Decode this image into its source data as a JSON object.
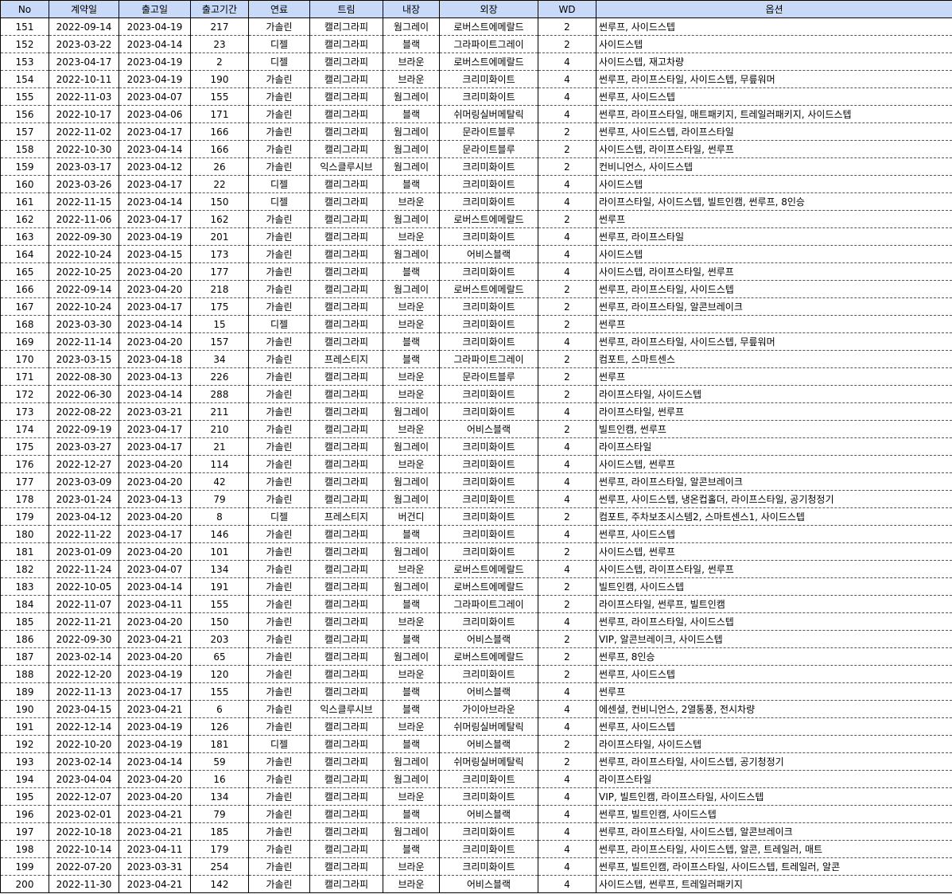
{
  "columns": [
    "No",
    "계약일",
    "출고일",
    "출고기간",
    "연료",
    "트림",
    "내장",
    "외장",
    "WD",
    "옵션"
  ],
  "header_color": "#c9daf8",
  "rows": [
    [
      "151",
      "2022-09-14",
      "2023-04-19",
      "217",
      "가솔린",
      "캘리그라피",
      "웜그레이",
      "로버스트에메랄드",
      "2",
      "썬루프, 사이드스텝"
    ],
    [
      "152",
      "2023-03-22",
      "2023-04-14",
      "23",
      "디젤",
      "캘리그라피",
      "블랙",
      "그라파이트그레이",
      "2",
      "사이드스텝"
    ],
    [
      "153",
      "2023-04-17",
      "2023-04-19",
      "2",
      "디젤",
      "캘리그라피",
      "브라운",
      "로버스트에메랄드",
      "4",
      "사이드스텝, 재고차량"
    ],
    [
      "154",
      "2022-10-11",
      "2023-04-19",
      "190",
      "가솔린",
      "캘리그라피",
      "브라운",
      "크리미화이트",
      "4",
      "썬루프, 라이프스타일, 사이드스텝, 무릎워머"
    ],
    [
      "155",
      "2022-11-03",
      "2023-04-07",
      "155",
      "가솔린",
      "캘리그라피",
      "웜그레이",
      "크리미화이트",
      "4",
      "썬루프, 사이드스텝"
    ],
    [
      "156",
      "2022-10-17",
      "2023-04-06",
      "171",
      "가솔린",
      "캘리그라피",
      "블랙",
      "쉬머링실버메탈릭",
      "4",
      "썬루프, 라이프스타일, 매트패키지, 트레일러패키지, 사이드스텝"
    ],
    [
      "157",
      "2022-11-02",
      "2023-04-17",
      "166",
      "가솔린",
      "캘리그라피",
      "웜그레이",
      "문라이트블루",
      "2",
      "썬루프, 사이드스텝, 라이프스타일"
    ],
    [
      "158",
      "2022-10-30",
      "2023-04-14",
      "166",
      "가솔린",
      "캘리그라피",
      "웜그레이",
      "문라이트블루",
      "2",
      "사이드스텝, 라이프스타일, 썬루프"
    ],
    [
      "159",
      "2023-03-17",
      "2023-04-12",
      "26",
      "가솔린",
      "익스클루시브",
      "웜그레이",
      "크리미화이트",
      "2",
      "컨비니언스, 사이드스텝"
    ],
    [
      "160",
      "2023-03-26",
      "2023-04-17",
      "22",
      "디젤",
      "캘리그라피",
      "블랙",
      "크리미화이트",
      "4",
      "사이드스텝"
    ],
    [
      "161",
      "2022-11-15",
      "2023-04-14",
      "150",
      "디젤",
      "캘리그라피",
      "브라운",
      "크리미화이트",
      "4",
      "라이프스타일, 사이드스텝, 빌트인캠, 썬루프, 8인승"
    ],
    [
      "162",
      "2022-11-06",
      "2023-04-17",
      "162",
      "가솔린",
      "캘리그라피",
      "웜그레이",
      "로버스트에메랄드",
      "2",
      "썬루프"
    ],
    [
      "163",
      "2022-09-30",
      "2023-04-19",
      "201",
      "가솔린",
      "캘리그라피",
      "브라운",
      "크리미화이트",
      "4",
      "썬루프, 라이프스타일"
    ],
    [
      "164",
      "2022-10-24",
      "2023-04-15",
      "173",
      "가솔린",
      "캘리그라피",
      "웜그레이",
      "어비스블랙",
      "4",
      "사이드스텝"
    ],
    [
      "165",
      "2022-10-25",
      "2023-04-20",
      "177",
      "가솔린",
      "캘리그라피",
      "블랙",
      "크리미화이트",
      "4",
      "사이드스텝, 라이프스타일, 썬루프"
    ],
    [
      "166",
      "2022-09-14",
      "2023-04-20",
      "218",
      "가솔린",
      "캘리그라피",
      "웜그레이",
      "로버스트에메랄드",
      "2",
      "썬루프, 라이프스타일, 사이드스텝"
    ],
    [
      "167",
      "2022-10-24",
      "2023-04-17",
      "175",
      "가솔린",
      "캘리그라피",
      "브라운",
      "크리미화이트",
      "2",
      "썬루프, 라이프스타일, 알콘브레이크"
    ],
    [
      "168",
      "2023-03-30",
      "2023-04-14",
      "15",
      "디젤",
      "캘리그라피",
      "브라운",
      "크리미화이트",
      "2",
      "썬루프"
    ],
    [
      "169",
      "2022-11-14",
      "2023-04-20",
      "157",
      "가솔린",
      "캘리그라피",
      "블랙",
      "크리미화이트",
      "4",
      "썬루프, 라이프스타일, 사이드스텝, 무릎워머"
    ],
    [
      "170",
      "2023-03-15",
      "2023-04-18",
      "34",
      "가솔린",
      "프레스티지",
      "블랙",
      "그라파이트그레이",
      "2",
      "컴포트, 스마트센스"
    ],
    [
      "171",
      "2022-08-30",
      "2023-04-13",
      "226",
      "가솔린",
      "캘리그라피",
      "브라운",
      "문라이트블루",
      "2",
      "썬루프"
    ],
    [
      "172",
      "2022-06-30",
      "2023-04-14",
      "288",
      "가솔린",
      "캘리그라피",
      "브라운",
      "크리미화이트",
      "2",
      "라이프스타일, 사이드스텝"
    ],
    [
      "173",
      "2022-08-22",
      "2023-03-21",
      "211",
      "가솔린",
      "캘리그라피",
      "웜그레이",
      "크리미화이트",
      "4",
      "라이프스타일, 썬루프"
    ],
    [
      "174",
      "2022-09-19",
      "2023-04-17",
      "210",
      "가솔린",
      "캘리그라피",
      "브라운",
      "어비스블랙",
      "2",
      "빌트인캠, 썬루프"
    ],
    [
      "175",
      "2023-03-27",
      "2023-04-17",
      "21",
      "가솔린",
      "캘리그라피",
      "웜그레이",
      "크리미화이트",
      "4",
      "라이프스타일"
    ],
    [
      "176",
      "2022-12-27",
      "2023-04-20",
      "114",
      "가솔린",
      "캘리그라피",
      "브라운",
      "크리미화이트",
      "4",
      "사이드스텝, 썬루프"
    ],
    [
      "177",
      "2023-03-09",
      "2023-04-20",
      "42",
      "가솔린",
      "캘리그라피",
      "웜그레이",
      "크리미화이트",
      "4",
      "썬루프, 라이프스타일, 알콘브레이크"
    ],
    [
      "178",
      "2023-01-24",
      "2023-04-13",
      "79",
      "가솔린",
      "캘리그라피",
      "웜그레이",
      "크리미화이트",
      "4",
      "썬루프, 사이드스텝, 냉온컵홀더, 라이프스타일, 공기청정기"
    ],
    [
      "179",
      "2023-04-12",
      "2023-04-20",
      "8",
      "디젤",
      "프레스티지",
      "버건디",
      "크리미화이트",
      "2",
      "컴포트, 주차보조시스템2, 스마트센스1, 사이드스텝"
    ],
    [
      "180",
      "2022-11-22",
      "2023-04-17",
      "146",
      "가솔린",
      "캘리그라피",
      "블랙",
      "크리미화이트",
      "4",
      "썬루프, 사이드스텝"
    ],
    [
      "181",
      "2023-01-09",
      "2023-04-20",
      "101",
      "가솔린",
      "캘리그라피",
      "웜그레이",
      "크리미화이트",
      "2",
      "사이드스텝, 썬루프"
    ],
    [
      "182",
      "2022-11-24",
      "2023-04-07",
      "134",
      "가솔린",
      "캘리그라피",
      "브라운",
      "로버스트에메랄드",
      "4",
      "사이드스텝, 라이프스타일, 썬루프"
    ],
    [
      "183",
      "2022-10-05",
      "2023-04-14",
      "191",
      "가솔린",
      "캘리그라피",
      "웜그레이",
      "로버스트에메랄드",
      "2",
      "빌트인캠, 사이드스텝"
    ],
    [
      "184",
      "2022-11-07",
      "2023-04-11",
      "155",
      "가솔린",
      "캘리그라피",
      "블랙",
      "그라파이트그레이",
      "2",
      "라이프스타일, 썬루프, 빌트인캠"
    ],
    [
      "185",
      "2022-11-21",
      "2023-04-20",
      "150",
      "가솔린",
      "캘리그라피",
      "브라운",
      "크리미화이트",
      "4",
      "썬루프, 라이프스타일, 사이드스텝"
    ],
    [
      "186",
      "2022-09-30",
      "2023-04-21",
      "203",
      "가솔린",
      "캘리그라피",
      "블랙",
      "어비스블랙",
      "2",
      "VIP, 알콘브레이크, 사이드스텝"
    ],
    [
      "187",
      "2023-02-14",
      "2023-04-20",
      "65",
      "가솔린",
      "캘리그라피",
      "웜그레이",
      "로버스트에메랄드",
      "2",
      "썬루프, 8인승"
    ],
    [
      "188",
      "2022-12-20",
      "2023-04-19",
      "120",
      "가솔린",
      "캘리그라피",
      "브라운",
      "크리미화이트",
      "2",
      "썬루프, 사이드스텝"
    ],
    [
      "189",
      "2022-11-13",
      "2023-04-17",
      "155",
      "가솔린",
      "캘리그라피",
      "블랙",
      "어비스블랙",
      "4",
      "썬루프"
    ],
    [
      "190",
      "2023-04-15",
      "2023-04-21",
      "6",
      "가솔린",
      "익스클루시브",
      "블랙",
      "가이아브라운",
      "4",
      "에센셜, 컨비니언스, 2열통풍, 전시차량"
    ],
    [
      "191",
      "2022-12-14",
      "2023-04-19",
      "126",
      "가솔린",
      "캘리그라피",
      "브라운",
      "쉬머링실버메탈릭",
      "4",
      "썬루프, 사이드스텝"
    ],
    [
      "192",
      "2022-10-20",
      "2023-04-19",
      "181",
      "디젤",
      "캘리그라피",
      "블랙",
      "어비스블랙",
      "2",
      "라이프스타일, 사이드스텝"
    ],
    [
      "193",
      "2023-02-14",
      "2023-04-14",
      "59",
      "가솔린",
      "캘리그라피",
      "웜그레이",
      "쉬머링실버메탈릭",
      "2",
      "썬루프, 라이프스타일, 사이드스텝, 공기청정기"
    ],
    [
      "194",
      "2023-04-04",
      "2023-04-20",
      "16",
      "가솔린",
      "캘리그라피",
      "웜그레이",
      "크리미화이트",
      "4",
      "라이프스타일"
    ],
    [
      "195",
      "2022-12-07",
      "2023-04-20",
      "134",
      "가솔린",
      "캘리그라피",
      "브라운",
      "크리미화이트",
      "4",
      "VIP, 빌트인캠, 라이프스타일, 사이드스텝"
    ],
    [
      "196",
      "2023-02-01",
      "2023-04-21",
      "79",
      "가솔린",
      "캘리그라피",
      "블랙",
      "어비스블랙",
      "4",
      "썬루프, 빌트인캠, 사이드스텝"
    ],
    [
      "197",
      "2022-10-18",
      "2023-04-21",
      "185",
      "가솔린",
      "캘리그라피",
      "웜그레이",
      "크리미화이트",
      "4",
      "썬루프, 라이프스타일, 사이드스텝, 알콘브레이크"
    ],
    [
      "198",
      "2022-10-14",
      "2023-04-11",
      "179",
      "가솔린",
      "캘리그라피",
      "블랙",
      "크리미화이트",
      "4",
      "썬루프, 라이프스타일, 사이드스텝, 알콘, 트레일러, 매트"
    ],
    [
      "199",
      "2022-07-20",
      "2023-03-31",
      "254",
      "가솔린",
      "캘리그라피",
      "브라운",
      "크리미화이트",
      "4",
      "썬루프, 빌트인캠, 라이프스타일, 사이드스텝, 트레일러, 알콘"
    ],
    [
      "200",
      "2022-11-30",
      "2023-04-21",
      "142",
      "가솔린",
      "캘리그라피",
      "브라운",
      "어비스블랙",
      "4",
      "사이드스텝, 썬루프, 트레일러패키지"
    ]
  ]
}
